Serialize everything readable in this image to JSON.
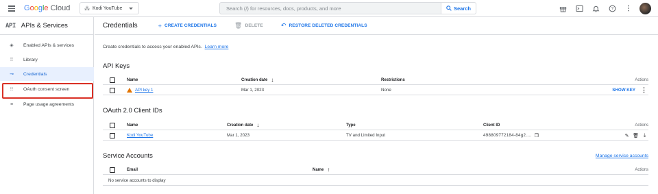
{
  "topbar": {
    "logo": {
      "g": "G",
      "o1": "o",
      "o2": "o",
      "g2": "g",
      "l": "l",
      "e": "e",
      "cloud": " Cloud"
    },
    "project": "Kodi YouTube",
    "search_placeholder": "Search (/) for resources, docs, products, and more",
    "search_button": "Search",
    "icons": [
      "gift-icon",
      "terminal-icon",
      "bell-icon",
      "help-icon",
      "more-vert-icon",
      "avatar"
    ]
  },
  "sidebar": {
    "api_mark": "API",
    "title": "APIs & Services",
    "items": [
      {
        "label": "Enabled APIs & services",
        "icon": "diamond-icon"
      },
      {
        "label": "Library",
        "icon": "library-icon"
      },
      {
        "label": "Credentials",
        "icon": "key-icon",
        "active": true
      },
      {
        "label": "OAuth consent screen",
        "icon": "consent-icon",
        "highlighted": true
      },
      {
        "label": "Page usage agreements",
        "icon": "settings-list-icon"
      }
    ]
  },
  "main": {
    "title": "Credentials",
    "actions": {
      "create": "CREATE CREDENTIALS",
      "delete": "DELETE",
      "restore": "RESTORE DELETED CREDENTIALS"
    },
    "intro": "Create credentials to access your enabled APIs.",
    "learn_more": "Learn more",
    "api_keys": {
      "title": "API Keys",
      "headers": {
        "name": "Name",
        "created": "Creation date",
        "restrictions": "Restrictions",
        "actions": "Actions"
      },
      "rows": [
        {
          "name": "API key 1",
          "created": "Mar 1, 2023",
          "restrictions": "None",
          "action": "SHOW KEY"
        }
      ]
    },
    "oauth": {
      "title": "OAuth 2.0 Client IDs",
      "headers": {
        "name": "Name",
        "created": "Creation date",
        "type": "Type",
        "client_id": "Client ID",
        "actions": "Actions"
      },
      "rows": [
        {
          "name": "Kodi YouTube",
          "created": "Mar 1, 2023",
          "type": "TV and Limited Input",
          "client_id": "498809772184-84g2...."
        }
      ]
    },
    "service_accounts": {
      "title": "Service Accounts",
      "manage": "Manage service accounts",
      "headers": {
        "email": "Email",
        "name": "Name",
        "actions": "Actions"
      },
      "empty": "No service accounts to display"
    }
  },
  "colors": {
    "accent": "#1a73e8",
    "highlight": "#d93025",
    "warning": "#e37400",
    "active_bg": "#e8f0fe"
  }
}
